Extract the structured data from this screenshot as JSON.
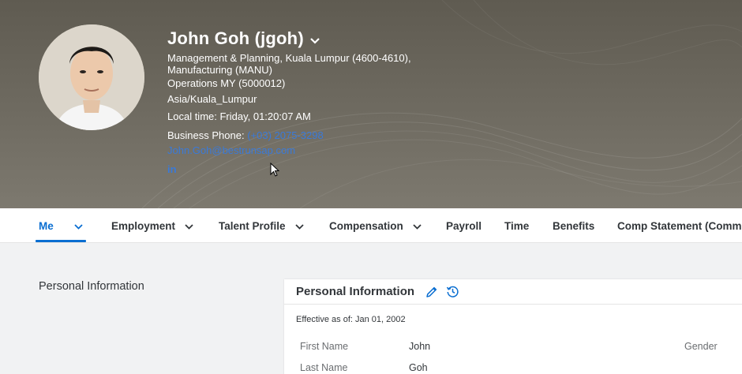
{
  "profile": {
    "name": "John Goh (jgoh)",
    "department": "Management & Planning, Kuala Lumpur (4600-4610),",
    "division": "Manufacturing (MANU)",
    "location": "Operations MY (5000012)",
    "timezone": "Asia/Kuala_Lumpur",
    "local_time": "Local time: Friday, 01:20:07 AM",
    "business_phone_label": "Business Phone:",
    "business_phone": "(+03) 2075-3298",
    "email": "John.Goh@bestrunsap.com",
    "linkedin": "in"
  },
  "nav": {
    "tabs": [
      {
        "label": "Me",
        "has_menu": true,
        "active": true
      },
      {
        "label": "Employment",
        "has_menu": true
      },
      {
        "label": "Talent Profile",
        "has_menu": true
      },
      {
        "label": "Compensation",
        "has_menu": true
      },
      {
        "label": "Payroll",
        "has_menu": false
      },
      {
        "label": "Time",
        "has_menu": false
      },
      {
        "label": "Benefits",
        "has_menu": false
      },
      {
        "label": "Comp Statement (Commi",
        "has_menu": false
      }
    ]
  },
  "content": {
    "section_label": "Personal Information",
    "card": {
      "title": "Personal Information",
      "effective": "Effective as of: Jan 01, 2002",
      "fields": [
        {
          "label": "First Name",
          "value": "John"
        },
        {
          "label": "Last Name",
          "value": "Goh"
        }
      ],
      "gender_label": "Gender"
    }
  },
  "colors": {
    "accent": "#0a6ed1",
    "link": "#3a7ad9",
    "header_bg": "#6b675d"
  },
  "icons": [
    "chevron-down-icon",
    "edit-pencil-icon",
    "history-icon",
    "linkedin-icon",
    "mouse-cursor-icon"
  ]
}
